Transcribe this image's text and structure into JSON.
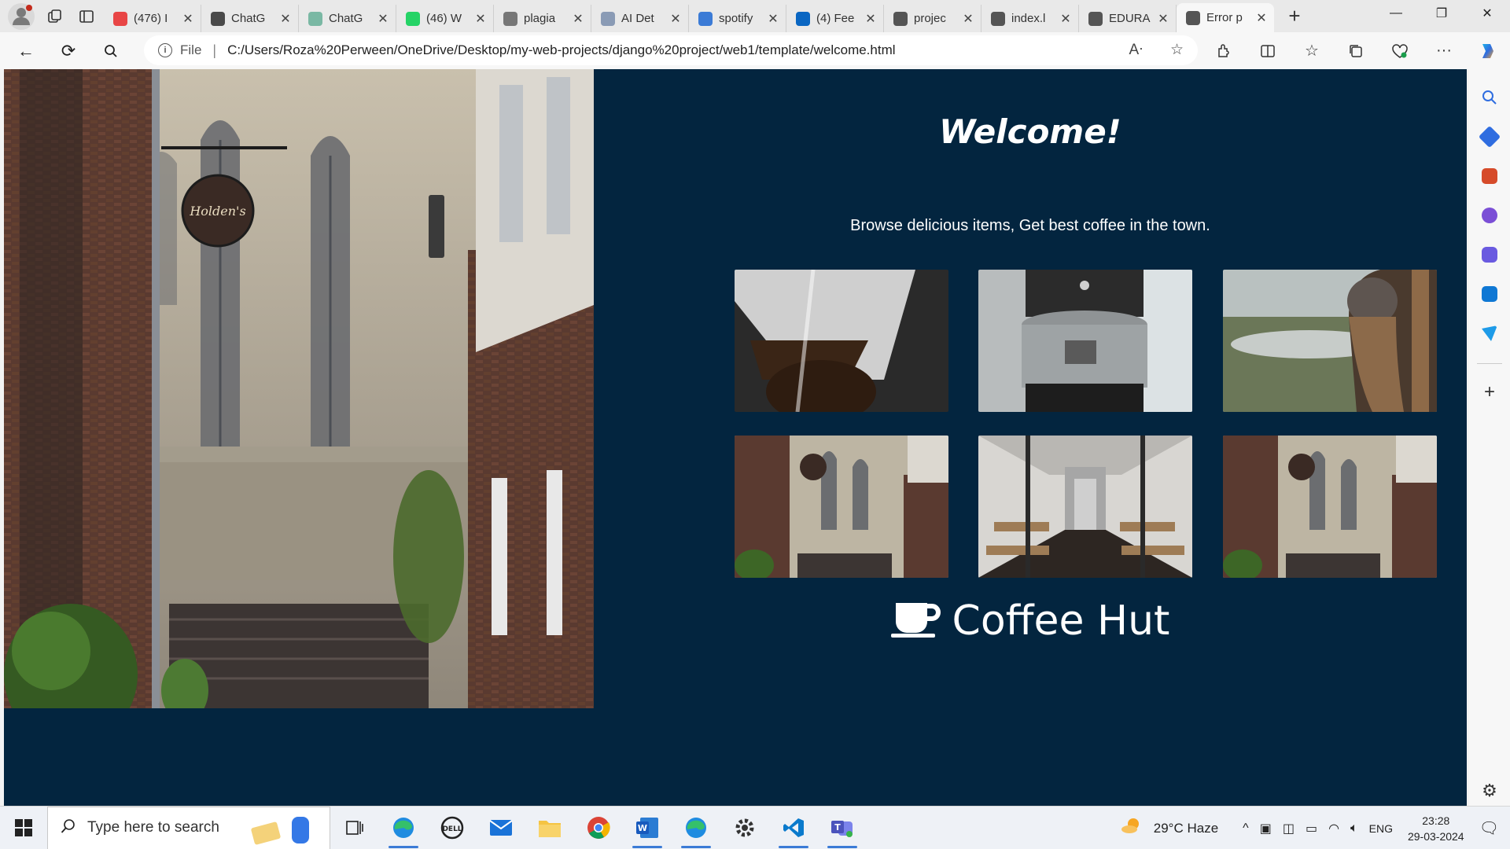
{
  "browser": {
    "tabs": [
      {
        "title": "(476) I",
        "favicon": "youtube-icon",
        "color": "#e84545",
        "active": false
      },
      {
        "title": "ChatG",
        "favicon": "chatgpt-icon",
        "color": "#4a4a4a",
        "active": false
      },
      {
        "title": "ChatG",
        "favicon": "chatgpt-icon",
        "color": "#7ab8a4",
        "active": false
      },
      {
        "title": "(46) W",
        "favicon": "whatsapp-icon",
        "color": "#25d366",
        "active": false
      },
      {
        "title": "plagia",
        "favicon": "plagiarism-icon",
        "color": "#777777",
        "active": false
      },
      {
        "title": "AI Det",
        "favicon": "ai-detector-icon",
        "color": "#8a9bb5",
        "active": false
      },
      {
        "title": "spotify",
        "favicon": "search-icon",
        "color": "#3b7bd6",
        "active": false
      },
      {
        "title": "(4) Fee",
        "favicon": "linkedin-icon",
        "color": "#0a66c2",
        "active": false
      },
      {
        "title": "projec",
        "favicon": "document-icon",
        "color": "#555555",
        "active": false
      },
      {
        "title": "index.l",
        "favicon": "document-icon",
        "color": "#555555",
        "active": false
      },
      {
        "title": "EDURA",
        "favicon": "document-icon",
        "color": "#555555",
        "active": false
      },
      {
        "title": "Error p",
        "favicon": "document-icon",
        "color": "#555555",
        "active": true
      }
    ],
    "address": {
      "scheme_label": "File",
      "url": "C:/Users/Roza%20Perween/OneDrive/Desktop/my-web-projects/django%20project/web1/template/welcome.html"
    }
  },
  "page": {
    "heading": "Welcome!",
    "tagline": "Browse delicious items, Get best coffee in the town.",
    "brand_name": "Coffee Hut",
    "brand_icon": "coffee-cup-icon",
    "hero_image": "street-cafe-photo",
    "gallery": [
      {
        "name": "pour-over-coffee-photo"
      },
      {
        "name": "coffee-roaster-photo"
      },
      {
        "name": "woman-landscape-photo"
      },
      {
        "name": "street-cafe-photo"
      },
      {
        "name": "cafe-interior-photo"
      },
      {
        "name": "street-cafe-photo"
      }
    ],
    "background": "#03253f"
  },
  "taskbar": {
    "search_placeholder": "Type here to search",
    "weather": "29°C  Haze",
    "language": "ENG",
    "time": "23:28",
    "date": "29-03-2024"
  }
}
